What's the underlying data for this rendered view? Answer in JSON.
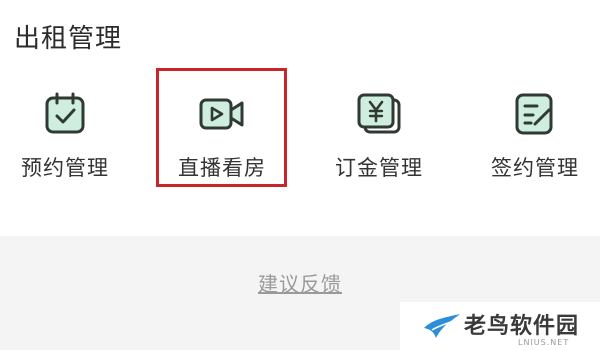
{
  "section": {
    "title": "出租管理"
  },
  "menu": {
    "items": [
      {
        "label": "预约管理",
        "icon": "calendar-check-icon"
      },
      {
        "label": "直播看房",
        "icon": "video-play-icon"
      },
      {
        "label": "订金管理",
        "icon": "yen-card-icon"
      },
      {
        "label": "签约管理",
        "icon": "contract-edit-icon"
      }
    ],
    "highlighted_index": 1
  },
  "footer": {
    "feedback_label": "建议反馈"
  },
  "watermark": {
    "name": "老鸟软件园",
    "domain": "LNIUS.NET"
  },
  "colors": {
    "icon_stroke": "#2f3a33",
    "icon_fill": "#cfeee0",
    "highlight": "#c8262a",
    "footer_bg": "#f4f4f4",
    "link_text": "#9a9a9a",
    "logo_blue": "#2a8ed8"
  }
}
